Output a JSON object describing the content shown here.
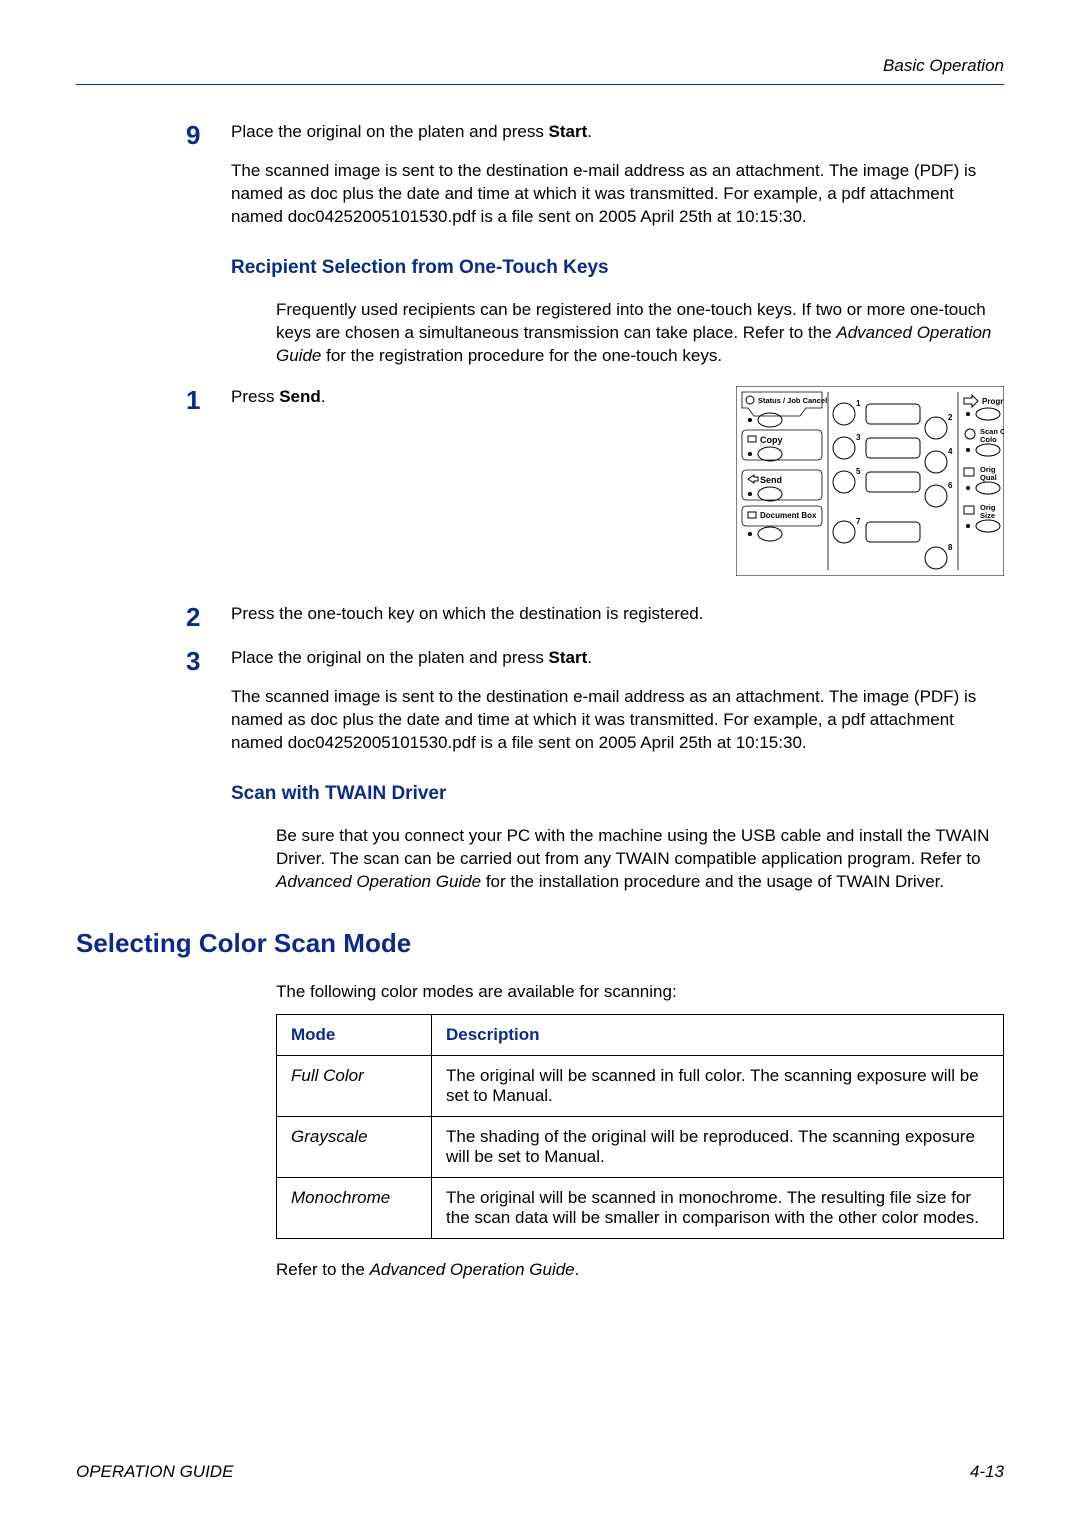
{
  "header": {
    "running": "Basic Operation"
  },
  "steps_a": {
    "s9": {
      "num": "9",
      "line": "Place the original on the platen and press ",
      "bold": "Start",
      "after": ".",
      "para": "The scanned image is sent to the destination e-mail address as an attachment. The image (PDF) is named as doc plus the date and time at which it was transmitted. For example, a pdf attachment named doc04252005101530.pdf is a file sent on 2005 April 25th at 10:15:30."
    }
  },
  "section_recipient": {
    "heading": "Recipient Selection from One-Touch Keys",
    "intro_p1": "Frequently used recipients can be registered into the one-touch keys. If two or more one-touch keys are chosen a simultaneous transmission can take place. Refer to the ",
    "intro_em": "Advanced Operation Guide",
    "intro_p2": " for the registration procedure for the one-touch keys.",
    "s1": {
      "num": "1",
      "pre": "Press ",
      "bold": "Send",
      "after": "."
    },
    "s2": {
      "num": "2",
      "text": "Press the one-touch key on which the destination is registered."
    },
    "s3": {
      "num": "3",
      "pre": "Place the original on the platen and press ",
      "bold": "Start",
      "after": ".",
      "para": "The scanned image is sent to the destination e-mail address as an attachment. The image (PDF) is named as doc plus the date and time at which it was transmitted. For example, a pdf attachment named doc04252005101530.pdf is a file sent on 2005 April 25th at 10:15:30."
    }
  },
  "section_twain": {
    "heading": "Scan with TWAIN Driver",
    "p_pre": "Be sure that you connect your PC with the machine using the USB cable and install the TWAIN Driver. The scan can be carried out from any TWAIN compatible  application program. Refer to ",
    "p_em": "Advanced Operation Guide",
    "p_post": " for the installation procedure and the usage of TWAIN Driver."
  },
  "section_color": {
    "heading": "Selecting Color Scan Mode",
    "intro": "The following color modes are available for scanning:",
    "th_mode": "Mode",
    "th_desc": "Description",
    "rows": [
      {
        "mode": "Full Color",
        "desc": "The original will be scanned in full color. The scanning exposure will be set to Manual."
      },
      {
        "mode": "Grayscale",
        "desc": "The shading of the original will be reproduced. The scanning exposure will be set to Manual."
      },
      {
        "mode": "Monochrome",
        "desc": "The original will be scanned in monochrome. The resulting file size for the scan data will be smaller in comparison with the other color modes."
      }
    ],
    "outro_pre": "Refer to the ",
    "outro_em": "Advanced Operation Guide",
    "outro_post": "."
  },
  "panel": {
    "title": "Status / Job Cancel",
    "labels": {
      "copy": "Copy",
      "send": "Send",
      "document": "Document Box",
      "program": "Progr",
      "scan_color": "Scan Colo",
      "orig_qual": "Orig Qual",
      "orig_size": "Orig Size"
    },
    "nums": {
      "n1": "1",
      "n2": "2",
      "n3": "3",
      "n4": "4",
      "n5": "5",
      "n6": "6",
      "n7": "7",
      "n8": "8"
    }
  },
  "footer": {
    "left": "OPERATION GUIDE",
    "right": "4-13"
  }
}
